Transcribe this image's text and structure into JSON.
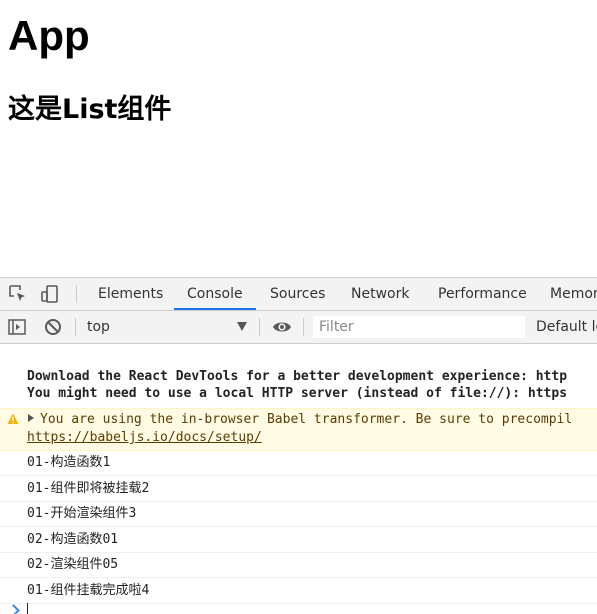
{
  "page": {
    "title": "App",
    "subtitle": "这是List组件"
  },
  "devtools": {
    "tabs": [
      "Elements",
      "Console",
      "Sources",
      "Network",
      "Performance",
      "Memor"
    ],
    "active_tab": "Console",
    "toolbar": {
      "context": "top",
      "filter_placeholder": "Filter",
      "levels": "Default le"
    },
    "console": {
      "info_lines": [
        "Download the React DevTools for a better development experience: http",
        "You might need to use a local HTTP server (instead of file://): https"
      ],
      "warning": {
        "text": "You are using the in-browser Babel transformer. Be sure to precompil",
        "link": "https://babeljs.io/docs/setup/"
      },
      "logs": [
        "01-构造函数1",
        "01-组件即将被挂载2",
        "01-开始渲染组件3",
        "02-构造函数01",
        "02-渲染组件05",
        "01-组件挂载完成啦4"
      ]
    }
  },
  "colors": {
    "accent": "#1a73e8",
    "warning_bg": "#fffbe5",
    "warning_text": "#5c3c00",
    "warning_icon": "#f4b400"
  }
}
